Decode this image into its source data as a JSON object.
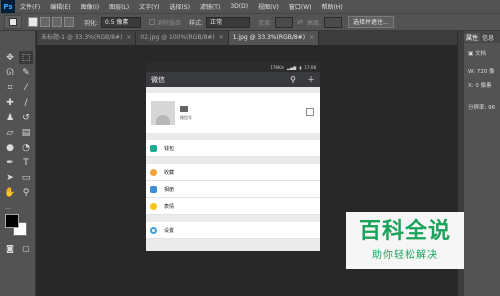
{
  "app": {
    "logo": "Ps"
  },
  "menu": [
    "文件(F)",
    "编辑(E)",
    "图像(I)",
    "图层(L)",
    "文字(Y)",
    "选择(S)",
    "滤镜(T)",
    "3D(D)",
    "视图(V)",
    "窗口(W)",
    "帮助(H)"
  ],
  "options": {
    "feather_label": "羽化:",
    "feather_value": "0.5 像素",
    "antialias_label": "消除锯齿",
    "style_label": "样式:",
    "style_value": "正常",
    "width_label": "宽度:",
    "height_label": "高度:",
    "select_mask_button": "选择并遮住..."
  },
  "tabs": [
    {
      "label": "未标题-1 @ 33.3%(RGB/8#)",
      "close": "×"
    },
    {
      "label": "02.jpg @ 100%(RGB/8#)",
      "close": "×"
    },
    {
      "label": "1.jpg @ 33.3%(RGB/8#)",
      "close": "×",
      "active": true
    }
  ],
  "phone": {
    "status_bar": {
      "signal": "176K/s",
      "time": "17:08"
    },
    "header": {
      "title": "微信",
      "search_icon": "search-icon",
      "add_icon": "plus-icon"
    },
    "profile": {
      "wechat_id": "微信号"
    },
    "menu_items": [
      {
        "label": "钱包",
        "icon_color": "#1aad8f"
      },
      {
        "label": "收藏",
        "icon_color": "#f2a23a"
      },
      {
        "label": "相册",
        "icon_color": "#3b8fd9"
      },
      {
        "label": "表情",
        "icon_color": "#f5c518"
      },
      {
        "label": "设置",
        "icon_color": "#3ba1d9"
      }
    ]
  },
  "properties_panel": {
    "tab_properties": "属性",
    "tab_info": "信息",
    "doc_label": "文档",
    "w_label": "W:",
    "w_value": "720 像",
    "x_label": "X:",
    "x_value": "0 像素",
    "resolution": "分辨率: 96"
  },
  "watermark": {
    "title": "百科全说",
    "subtitle": "助你轻松解决"
  },
  "colors": {
    "accent": "#1aa35b",
    "ps_blue": "#31a8ff"
  }
}
